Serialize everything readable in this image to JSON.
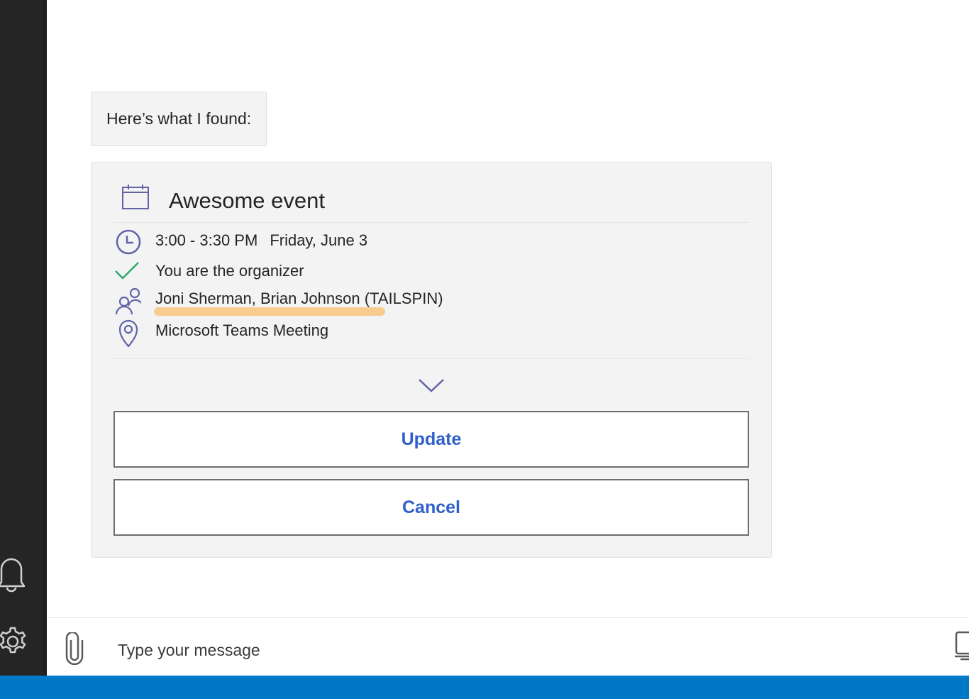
{
  "chat": {
    "bubble_text": "Here’s what I found:"
  },
  "event_card": {
    "title": "Awesome event",
    "time": "3:00 - 3:30 PM",
    "date": "Friday, June 3",
    "organizer_text": "You are the organizer",
    "attendees": "Joni Sherman, Brian Johnson (TAILSPIN)",
    "location": "Microsoft Teams Meeting",
    "update_label": "Update",
    "cancel_label": "Cancel"
  },
  "composer": {
    "placeholder": "Type your message"
  },
  "colors": {
    "icon_purple": "#6264a7",
    "check_green": "#2fa86a",
    "button_text_blue": "#2f5fca",
    "highlight_orange": "#f8c47c",
    "status_bar_blue": "#0078c8",
    "rail_dark": "#252526"
  },
  "icons": {
    "calendar": "calendar-icon",
    "clock": "clock-icon",
    "check": "checkmark-icon",
    "people": "people-icon",
    "location": "location-pin-icon",
    "expand": "chevron-down-icon",
    "attach": "paperclip-icon",
    "bell": "bell-icon",
    "settings": "gear-icon",
    "device": "device-icon"
  }
}
